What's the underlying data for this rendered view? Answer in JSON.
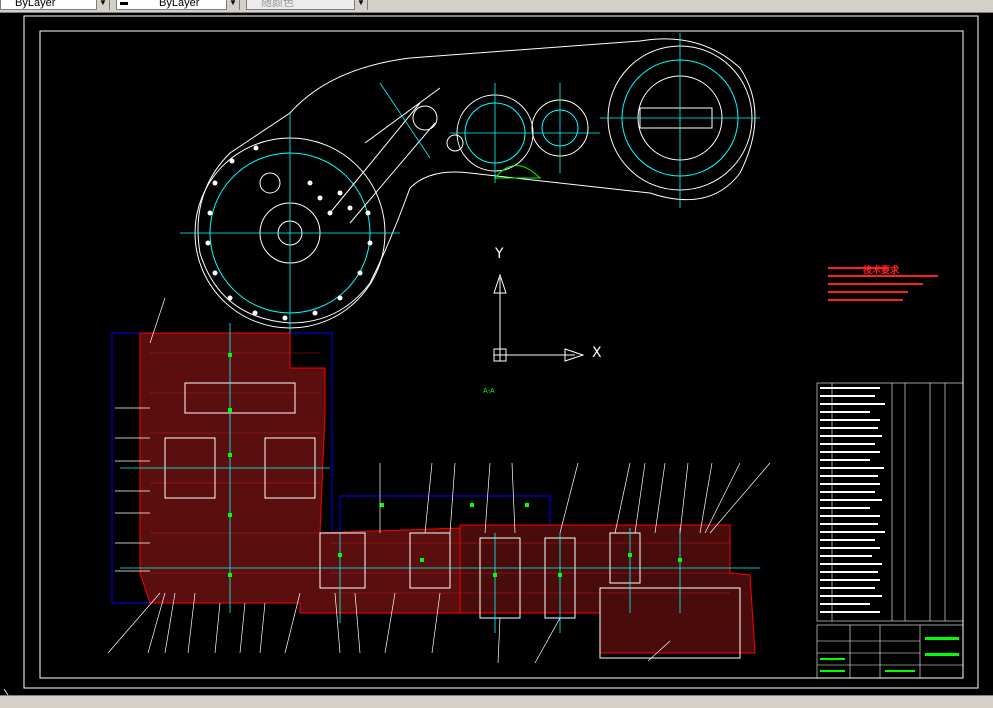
{
  "toolbar": {
    "linetype": {
      "value": "ByLayer",
      "icon": "chevron-down-icon"
    },
    "lineweight": {
      "value": "ByLayer",
      "icon": "chevron-down-icon"
    },
    "plotstyle": {
      "value": "随颜色",
      "icon": "chevron-down-icon"
    }
  },
  "drawing": {
    "ucs_y": "Y",
    "ucs_x": "X",
    "section_label": "A-A",
    "notes_title": "技术要求"
  },
  "colors": {
    "background": "#000000",
    "border": "#ffffff",
    "centerline": "#00ffff",
    "body": "#ff0000",
    "hatch": "#8b1a1a",
    "dimension": "#0000ff",
    "marker": "#00ff00",
    "ucs": "#ffffff",
    "notes": "#ff2020",
    "panel": "#d4d0c8"
  }
}
